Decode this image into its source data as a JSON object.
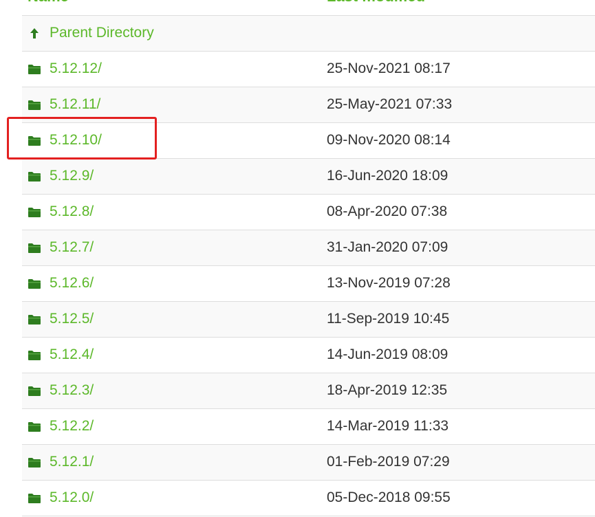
{
  "table": {
    "headers": {
      "name": "Name",
      "last_modified": "Last modified"
    },
    "parent": {
      "icon": "arrow-up-icon",
      "label": "Parent Directory"
    },
    "rows": [
      {
        "name": "5.12.12/",
        "date": "25-Nov-2021 08:17",
        "icon": "folder-icon"
      },
      {
        "name": "5.12.11/",
        "date": "25-May-2021 07:33",
        "icon": "folder-icon"
      },
      {
        "name": "5.12.10/",
        "date": "09-Nov-2020 08:14",
        "icon": "folder-icon"
      },
      {
        "name": "5.12.9/",
        "date": "16-Jun-2020 18:09",
        "icon": "folder-icon"
      },
      {
        "name": "5.12.8/",
        "date": "08-Apr-2020 07:38",
        "icon": "folder-icon"
      },
      {
        "name": "5.12.7/",
        "date": "31-Jan-2020 07:09",
        "icon": "folder-icon"
      },
      {
        "name": "5.12.6/",
        "date": "13-Nov-2019 07:28",
        "icon": "folder-icon"
      },
      {
        "name": "5.12.5/",
        "date": "11-Sep-2019 10:45",
        "icon": "folder-icon"
      },
      {
        "name": "5.12.4/",
        "date": "14-Jun-2019 08:09",
        "icon": "folder-icon"
      },
      {
        "name": "5.12.3/",
        "date": "18-Apr-2019 12:35",
        "icon": "folder-icon"
      },
      {
        "name": "5.12.2/",
        "date": "14-Mar-2019 11:33",
        "icon": "folder-icon"
      },
      {
        "name": "5.12.1/",
        "date": "01-Feb-2019 07:29",
        "icon": "folder-icon"
      },
      {
        "name": "5.12.0/",
        "date": "05-Dec-2018 09:55",
        "icon": "folder-icon"
      }
    ]
  },
  "highlight": {
    "target": "5.12.10/",
    "color": "#e32020"
  },
  "colors": {
    "link": "#5cb82a",
    "text": "#333333",
    "row_alt": "#f9f9f9",
    "border": "#dddddd"
  }
}
